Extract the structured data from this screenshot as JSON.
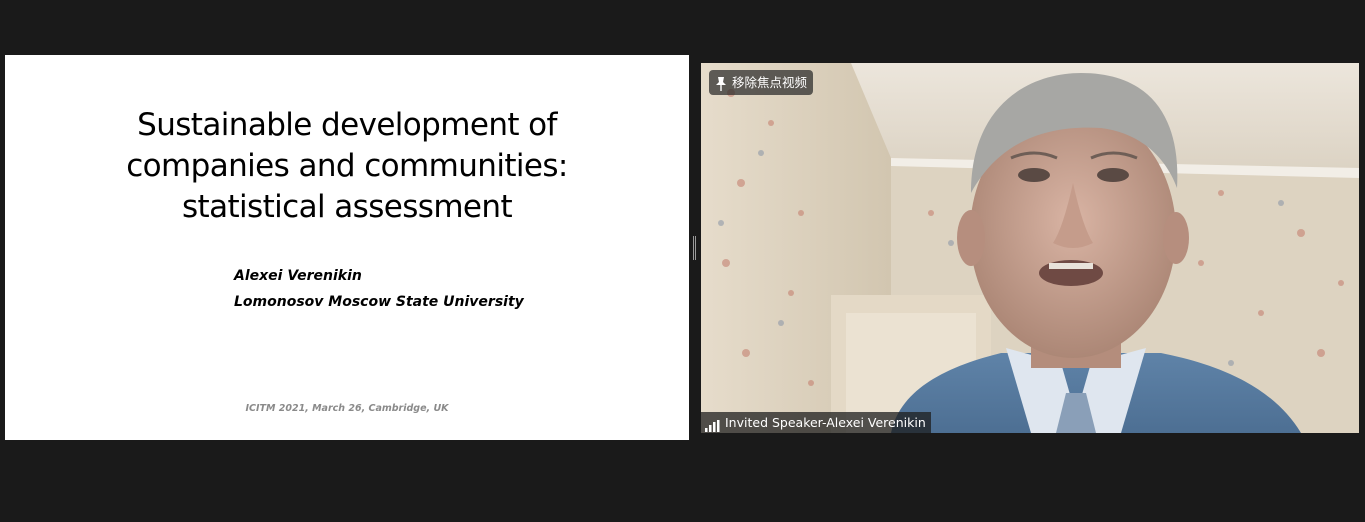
{
  "slide": {
    "title_lines": [
      "Sustainable development of",
      "companies and communities:",
      "statistical assessment"
    ],
    "author_name": "Alexei Verenikin",
    "author_affiliation": "Lomonosov Moscow State University",
    "footer": "ICITM 2021, March 26, Cambridge, UK"
  },
  "video": {
    "pin_label": "移除焦点视频",
    "pin_icon": "pin-icon",
    "participant_name": "Invited Speaker-Alexei Verenikin",
    "signal_icon": "signal-strength-icon"
  },
  "colors": {
    "background": "#1a1a1a",
    "slide_bg": "#ffffff",
    "footer_text": "#8a8a8a"
  }
}
